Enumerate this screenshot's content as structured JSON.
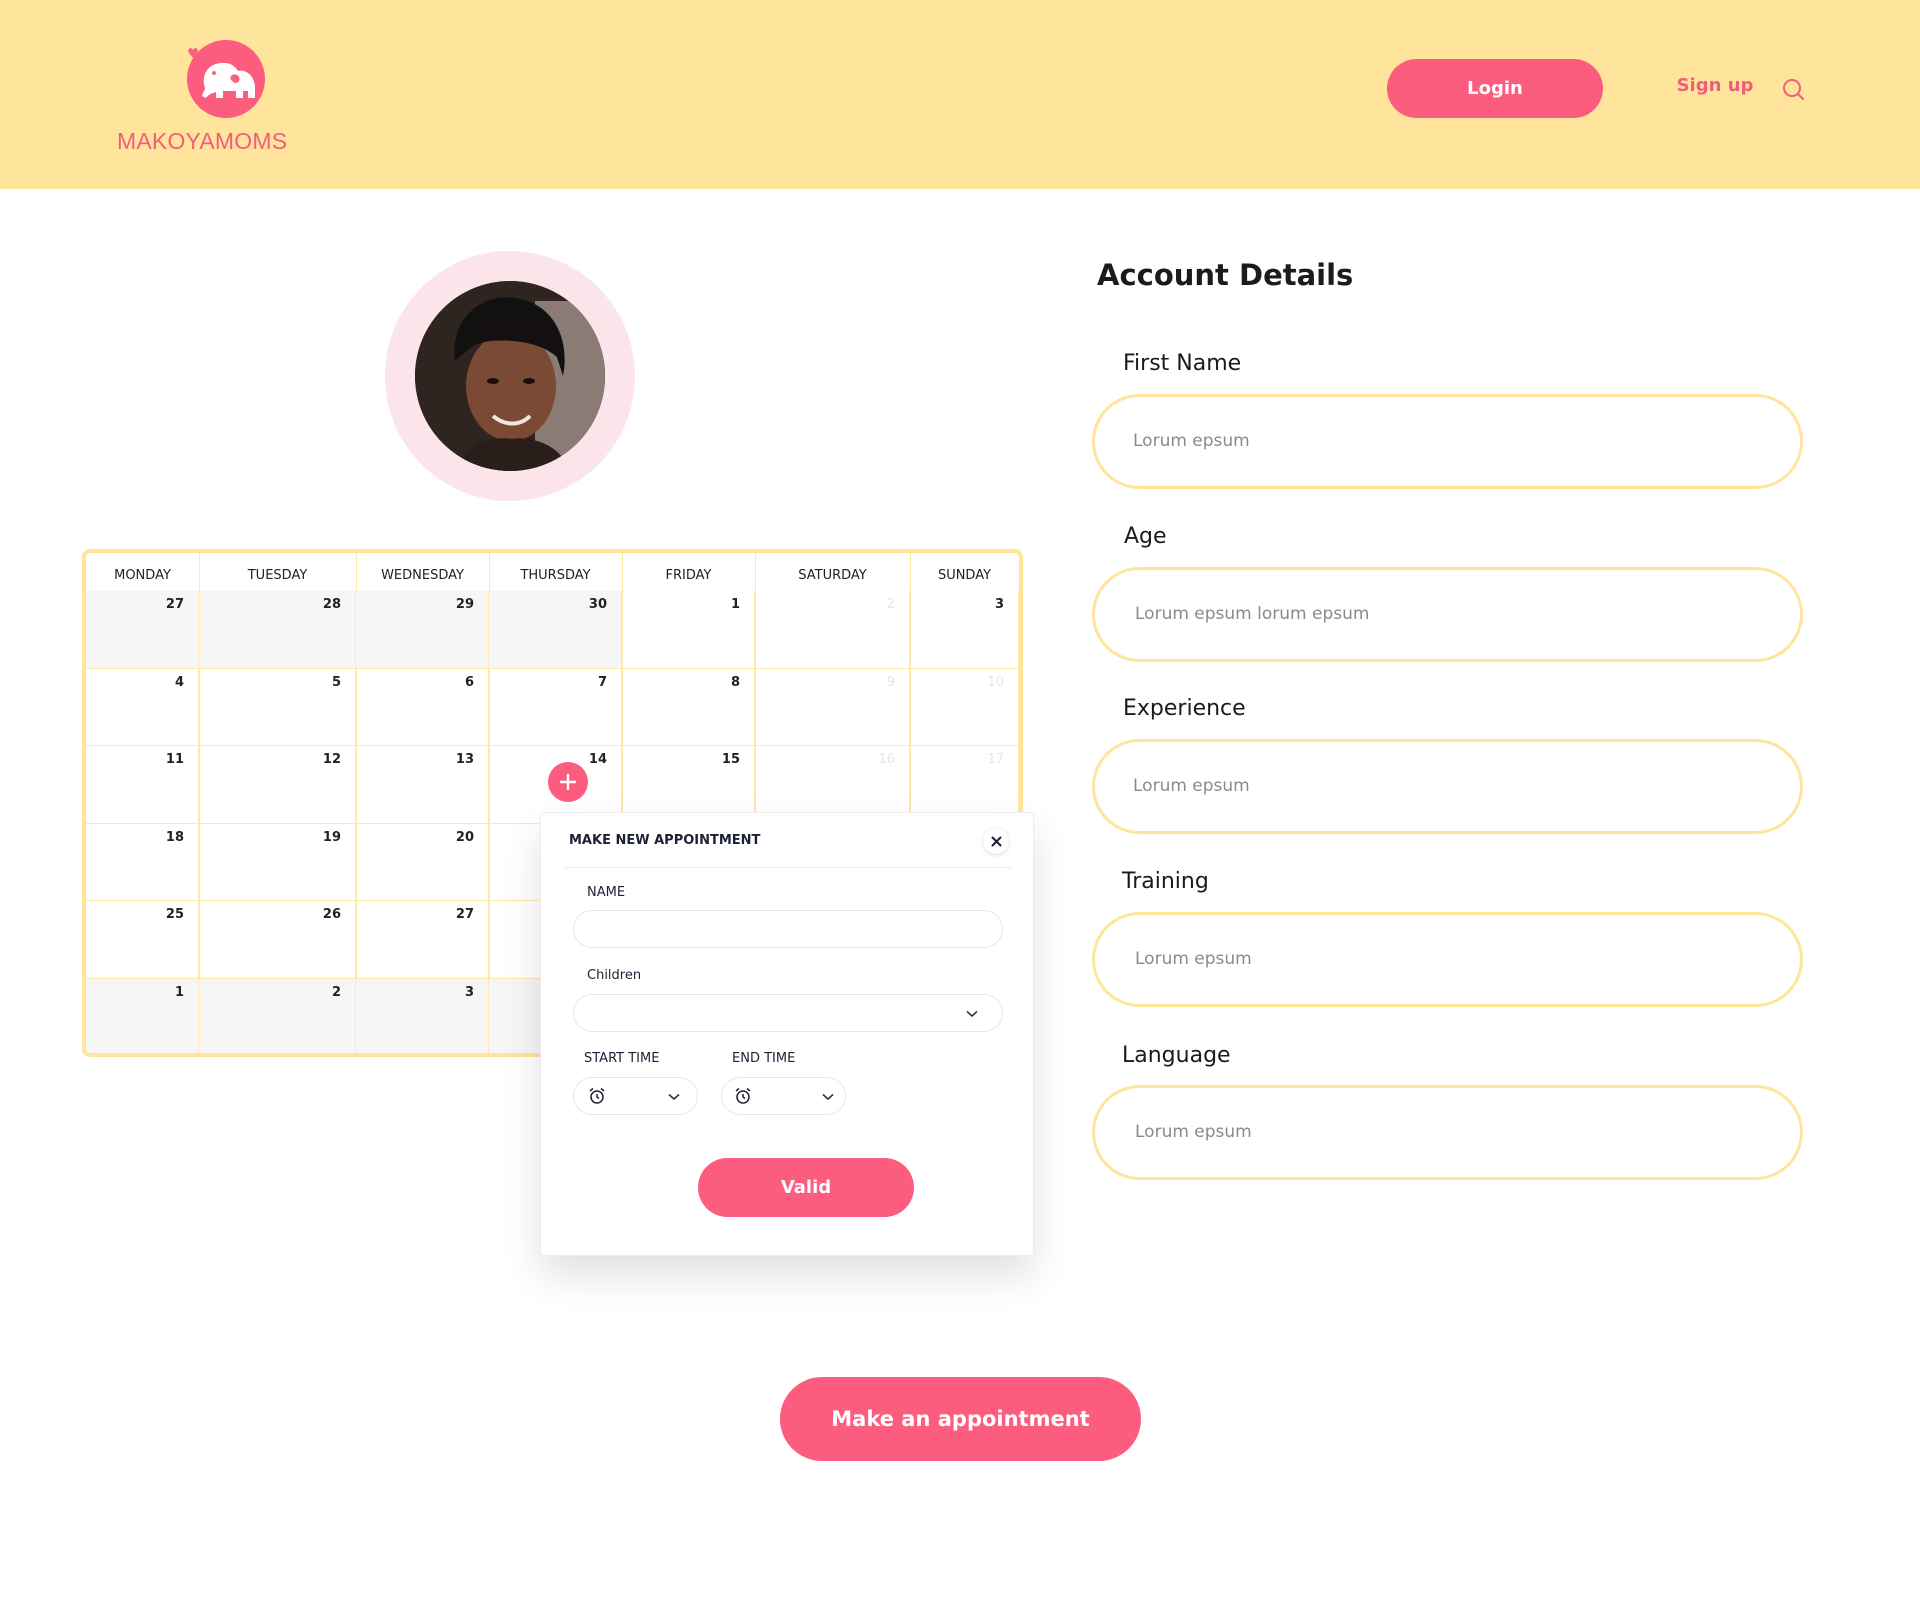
{
  "header": {
    "brand": "MAKOYAMOMS",
    "login_label": "Login",
    "signup_label": "Sign up"
  },
  "colors": {
    "accent": "#fc5c7d",
    "header_bg": "#ffe59b",
    "field_border": "#ffe59b"
  },
  "calendar": {
    "days": [
      "MONDAY",
      "TUESDAY",
      "WEDNESDAY",
      "THURSDAY",
      "FRIDAY",
      "SATURDAY",
      "SUNDAY"
    ],
    "weeks": [
      [
        "27",
        "28",
        "29",
        "30",
        "1",
        "2",
        "3"
      ],
      [
        "4",
        "5",
        "6",
        "7",
        "8",
        "9",
        "10"
      ],
      [
        "11",
        "12",
        "13",
        "14",
        "15",
        "16",
        "17"
      ],
      [
        "18",
        "19",
        "20",
        "",
        "",
        "",
        ""
      ],
      [
        "25",
        "26",
        "27",
        "",
        "",
        "",
        ""
      ],
      [
        "1",
        "2",
        "3",
        "",
        "",
        "",
        ""
      ]
    ]
  },
  "appointment_popup": {
    "title": "MAKE NEW APPOINTMENT",
    "name_label": "NAME",
    "name_value": "",
    "children_label": "Children",
    "children_value": "",
    "start_time_label": "START TIME",
    "end_time_label": "END TIME",
    "valid_label": "Valid"
  },
  "account": {
    "title": "Account Details",
    "fields": [
      {
        "label": "First Name",
        "placeholder": "Lorum epsum"
      },
      {
        "label": "Age",
        "placeholder": "Lorum epsum lorum epsum"
      },
      {
        "label": "Experience",
        "placeholder": "Lorum epsum"
      },
      {
        "label": "Training",
        "placeholder": "Lorum epsum"
      },
      {
        "label": "Language",
        "placeholder": "Lorum epsum"
      }
    ]
  },
  "cta_label": "Make an appointment"
}
